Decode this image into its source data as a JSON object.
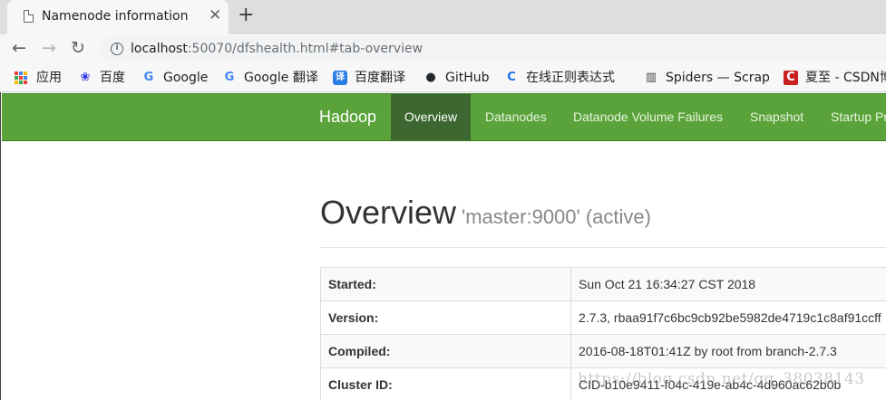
{
  "tab": {
    "title": "Namenode information",
    "close": "✕",
    "new_tab": "+"
  },
  "toolbar": {
    "back_icon": "←",
    "forward_icon": "→",
    "reload_icon": "↻",
    "info_icon": "i",
    "url_host": "localhost",
    "url_rest": ":50070/dfshealth.html#tab-overview"
  },
  "bookmarks": [
    {
      "label": "应用",
      "icon": "apps-grid-icon"
    },
    {
      "label": "百度",
      "icon": "baidu-paw-icon",
      "glyph": "❀",
      "color": "#2932e1"
    },
    {
      "label": "Google",
      "icon": "google-g-icon",
      "glyph": "G",
      "color": "#4285f4"
    },
    {
      "label": "Google 翻译",
      "icon": "google-translate-icon",
      "glyph": "G",
      "color": "#4285f4"
    },
    {
      "label": "百度翻译",
      "icon": "baidu-translate-icon",
      "glyph": "译",
      "color": "#2a7ee6"
    },
    {
      "label": "GitHub",
      "icon": "github-icon",
      "glyph": "●",
      "color": "#24292e"
    },
    {
      "label": "在线正则表达式",
      "icon": "regex-tool-icon",
      "glyph": "C",
      "color": "#1a73e8"
    },
    {
      "label": "Spiders — Scrapy",
      "icon": "scrapy-doc-icon",
      "glyph": "▥",
      "color": "#444"
    },
    {
      "label": "夏至 - CSDN博",
      "icon": "csdn-icon",
      "glyph": "C",
      "color": "#c9211e"
    }
  ],
  "navbar": {
    "brand": "Hadoop",
    "items": [
      "Overview",
      "Datanodes",
      "Datanode Volume Failures",
      "Snapshot",
      "Startup Progress"
    ],
    "active_index": 0,
    "color": "#5aa33a"
  },
  "overview": {
    "heading": "Overview",
    "subheading": "'master:9000' (active)",
    "rows": [
      {
        "key": "Started:",
        "value": "Sun Oct 21 16:34:27 CST 2018"
      },
      {
        "key": "Version:",
        "value": "2.7.3, rbaa91f7c6bc9cb92be5982de4719c1c8af91ccff"
      },
      {
        "key": "Compiled:",
        "value": "2016-08-18T01:41Z by root from branch-2.7.3"
      },
      {
        "key": "Cluster ID:",
        "value": "CID-b10e9411-f04c-419e-ab4c-4d960ac62b0b"
      }
    ]
  },
  "watermark": "https://blog.csdn.net/qq_38038143"
}
